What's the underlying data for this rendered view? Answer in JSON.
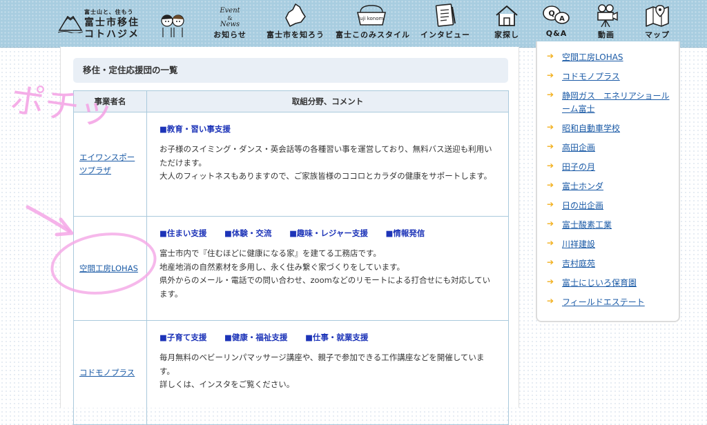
{
  "header": {
    "logo": {
      "line1": "富士山と、住もう",
      "line2": "富士市移住",
      "line3": "コトハジメ"
    },
    "nav": [
      {
        "icon": "event-news-icon",
        "icon_text": "Event & News",
        "label": "お知らせ"
      },
      {
        "icon": "fuji-map-icon",
        "label": "富士市を知ろう"
      },
      {
        "icon": "fuji-style-icon",
        "icon_text": "fuji konomi style",
        "label": "富士このみスタイル"
      },
      {
        "icon": "interview-icon",
        "label": "インタビュー"
      },
      {
        "icon": "house-icon",
        "label": "家探し"
      },
      {
        "icon": "qa-icon",
        "label": "Q&A"
      },
      {
        "icon": "video-camera-icon",
        "label": "動画"
      },
      {
        "icon": "map-icon",
        "label": "マップ"
      }
    ]
  },
  "main": {
    "section_title": "移住・定住応援団の一覧",
    "table": {
      "headers": [
        "事業者名",
        "取組分野、コメント"
      ],
      "rows": [
        {
          "name": "エイワンスポーツプラザ",
          "tags": [
            "■教育・習い事支援"
          ],
          "lines": [
            "お子様のスイミング・ダンス・英会話等の各種習い事を運営しており、無料バス送迎も利用いただけます。",
            "大人のフィットネスもありますので、ご家族皆様のココロとカラダの健康をサポートします。"
          ]
        },
        {
          "name": "空間工房LOHAS",
          "tags": [
            "■住まい支援",
            "■体験・交流",
            "■趣味・レジャー支援",
            "■情報発信"
          ],
          "lines": [
            "富士市内で『住むほどに健康になる家』を建てる工務店です。",
            "地産地消の自然素材を多用し、永く住み繋ぐ家づくりをしています。",
            "県外からのメール・電話での問い合わせ、zoomなどのリモートによる打合せにも対応しています。"
          ]
        },
        {
          "name": "コドモノプラス",
          "tags": [
            "■子育て支援",
            "■健康・福祉支援",
            "■仕事・就業支援"
          ],
          "lines": [
            "毎月無料のベビーリンパマッサージ講座や、親子で参加できる工作講座などを開催しています。",
            "詳しくは、インスタをご覧ください。"
          ]
        }
      ]
    }
  },
  "sidebar": {
    "arrow": "➔",
    "items": [
      "空間工房LOHAS",
      "コドモノプラス",
      "静岡ガス　エネリアショールーム富士",
      "昭和自動車学校",
      "高田企画",
      "田子の月",
      "富士ホンダ",
      "日の出企画",
      "富士酸素工業",
      "川祥建設",
      "吉村庭苑",
      "富士にじいろ保育園",
      "フィールドエステート"
    ]
  },
  "annotation": {
    "handwriting": "ポチッ"
  },
  "colors": {
    "header_bg": "#a8cde0",
    "link": "#1a5aa6",
    "tag": "#1d34b8",
    "arrow": "#f2b01e",
    "annotation": "#f4a6e6"
  }
}
